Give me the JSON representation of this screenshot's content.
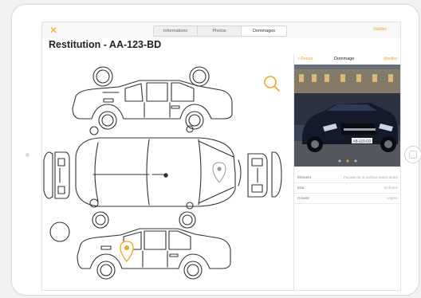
{
  "app": {
    "close_glyph": "✕",
    "tabs": [
      {
        "label": "Informations",
        "active": false
      },
      {
        "label": "Photos",
        "active": false
      },
      {
        "label": "Dommages",
        "active": true
      }
    ],
    "validate_label": "Valider",
    "title": "Restitution - AA-123-BD"
  },
  "panel": {
    "back_label": "< Retour",
    "title": "Dommage",
    "edit_label": "Modifier",
    "plate": "AB-123-CD",
    "pager_dots": 3,
    "active_dot": 1,
    "rows": [
      {
        "label": "Élément",
        "value": "Façade de la surface avant droite"
      },
      {
        "label": "Etat",
        "value": "Enfoncé"
      },
      {
        "label": "Gravité",
        "value": "Légère"
      }
    ]
  },
  "colors": {
    "accent": "#f5a623",
    "line": "#333333",
    "pin_gray": "#9a9a9a"
  },
  "icons": {
    "zoom": "search-icon",
    "close": "close-icon",
    "pin": "location-pin-icon"
  }
}
